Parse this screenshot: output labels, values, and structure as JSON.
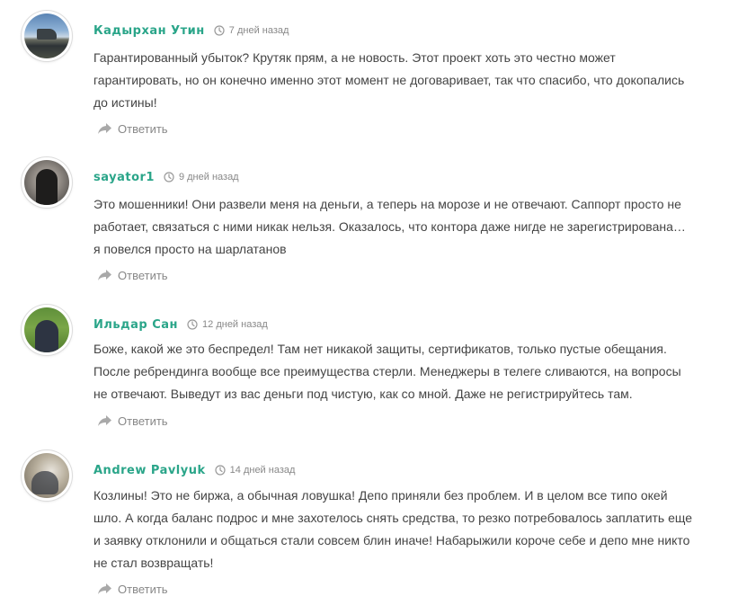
{
  "comments": [
    {
      "author": "Кадырхан Утин",
      "time": "7 дней назад",
      "text": "Гарантированный убыток? Крутяк прям, а не новость. Этот проект хоть это честно может гарантировать, но он конечно именно этот момент не договаривает, так что спасибо, что докопались до истины!",
      "reply_label": "Ответить",
      "avatar_icon": "user-avatar-icon"
    },
    {
      "author": "sayator1",
      "time": "9 дней назад",
      "text": "Это мошенники! Они развели меня на деньги, а теперь на морозе и не отвечают. Саппорт просто не работает, связаться с ними никак нельзя. Оказалось, что контора даже нигде не зарегистрирована… я повелся просто на шарлатанов",
      "reply_label": "Ответить",
      "avatar_icon": "user-avatar-icon"
    },
    {
      "author": "Ильдар Сан",
      "time": "12 дней назад",
      "text": "Боже, какой же это беспредел! Там нет никакой защиты, сертификатов, только пустые обещания. После ребрендинга вообще все преимущества стерли. Менеджеры в телеге сливаются, на вопросы не отвечают. Выведут из вас деньги под чистую, как со мной. Даже не регистрируйтесь там.",
      "reply_label": "Ответить",
      "avatar_icon": "user-avatar-icon"
    },
    {
      "author": "Andrew Pavlyuk",
      "time": "14 дней назад",
      "text": "Козлины! Это не биржа, а обычная ловушка! Депо приняли без проблем. И в целом все типо окей шло. А когда баланс подрос и мне захотелось снять средства, то резко потребовалось заплатить еще и заявку отклонили и общаться стали совсем блин иначе! Набарыжили короче себе и депо мне никто не стал возвращать!",
      "reply_label": "Ответить",
      "avatar_icon": "user-avatar-icon"
    }
  ],
  "colors": {
    "author": "#2aa589",
    "meta": "#888888",
    "text": "#444444"
  },
  "icons": {
    "time": "clock-icon",
    "reply": "reply-arrow-icon"
  }
}
